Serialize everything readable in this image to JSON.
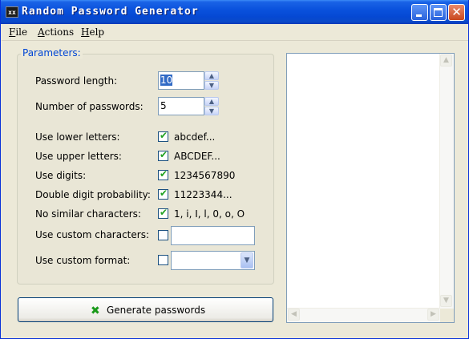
{
  "window": {
    "icon_text": "xx",
    "title": "Random Password Generator"
  },
  "menu": {
    "file": {
      "mnemonic": "F",
      "rest": "ile"
    },
    "actions": {
      "mnemonic": "A",
      "rest": "ctions"
    },
    "help": {
      "mnemonic": "H",
      "rest": "elp"
    }
  },
  "parameters": {
    "group_title": "Parameters:",
    "password_length": {
      "label": "Password length:",
      "value": "10"
    },
    "number_of_passwords": {
      "label": "Number of passwords:",
      "value": "5"
    },
    "options": [
      {
        "label": "Use lower letters:",
        "checked": true,
        "sample": "abcdef..."
      },
      {
        "label": "Use upper letters:",
        "checked": true,
        "sample": "ABCDEF..."
      },
      {
        "label": "Use digits:",
        "checked": true,
        "sample": "1234567890"
      },
      {
        "label": "Double digit probability:",
        "checked": true,
        "sample": "11223344..."
      },
      {
        "label": "No similar characters:",
        "checked": true,
        "sample": "1, i, I, l, 0, o, O"
      }
    ],
    "custom_characters": {
      "label": "Use custom characters:",
      "checked": false,
      "value": ""
    },
    "custom_format": {
      "label": "Use custom format:",
      "checked": false,
      "value": ""
    }
  },
  "generate_button": {
    "label": "Generate passwords"
  },
  "output": {
    "text": ""
  },
  "icons": {
    "check": "✔",
    "spin_up": "▲",
    "spin_down": "▼",
    "combo_arrow": "▼",
    "generate": "✖",
    "minimize": "",
    "close": "✕",
    "scroll_up": "▲",
    "scroll_down": "▼",
    "scroll_left": "◀",
    "scroll_right": "▶"
  },
  "colors": {
    "title_bar": "#0a52dd",
    "group_title": "#0046d5",
    "check_mark": "#21a121",
    "selection": "#316ac5"
  }
}
